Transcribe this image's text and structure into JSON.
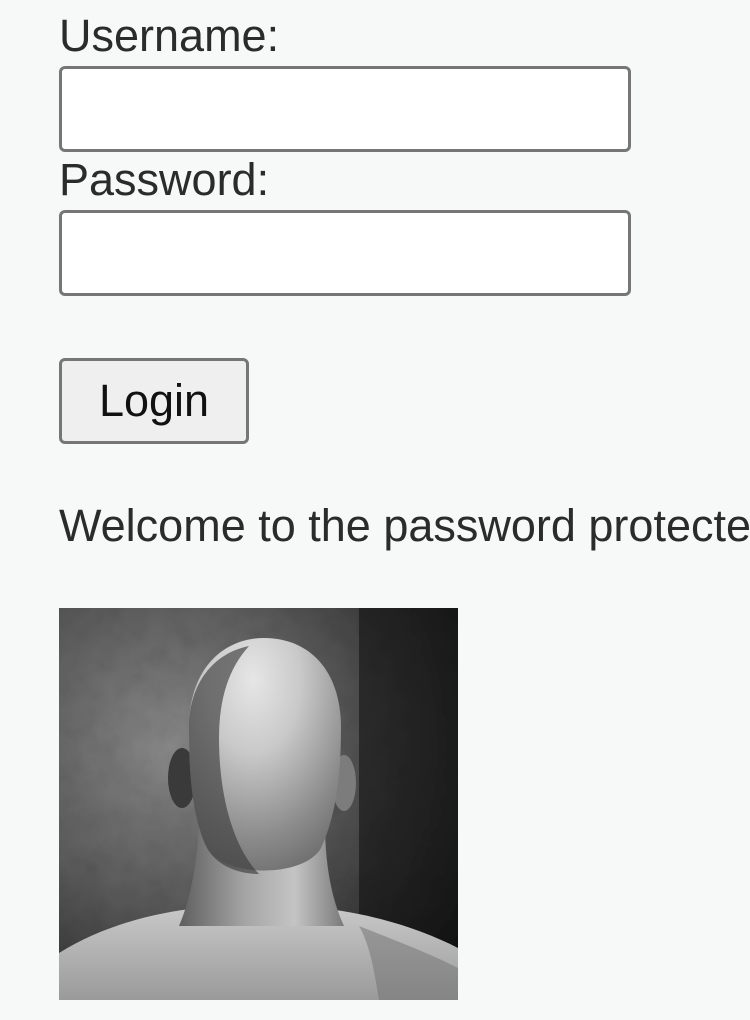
{
  "form": {
    "username_label": "Username:",
    "username_value": "",
    "password_label": "Password:",
    "password_value": "",
    "login_label": "Login"
  },
  "welcome_text": "Welcome to the password protected area",
  "photo": {
    "icon": "portrait-photo"
  }
}
